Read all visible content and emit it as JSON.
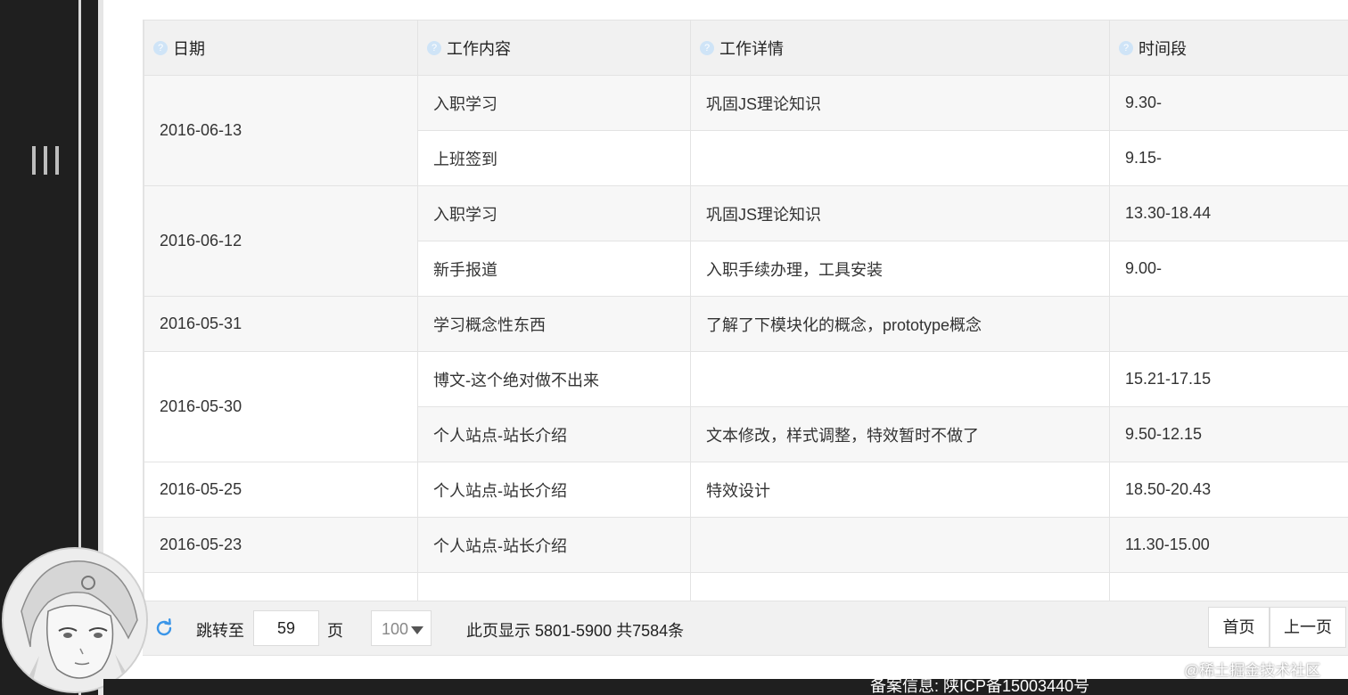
{
  "table": {
    "headers": [
      "日期",
      "工作内容",
      "工作详情",
      "时间段"
    ],
    "rows": [
      {
        "date": "2016-06-13",
        "content": "入职学习",
        "detail": "巩固JS理论知识",
        "time": "9.30-"
      },
      {
        "date": "",
        "content": "上班签到",
        "detail": "",
        "time": "9.15-"
      },
      {
        "date": "2016-06-12",
        "content": "入职学习",
        "detail": "巩固JS理论知识",
        "time": "13.30-18.44"
      },
      {
        "date": "",
        "content": "新手报道",
        "detail": "入职手续办理，工具安装",
        "time": "9.00-"
      },
      {
        "date": "2016-05-31",
        "content": "学习概念性东西",
        "detail": "了解了下模块化的概念，prototype概念",
        "time": ""
      },
      {
        "date": "2016-05-30",
        "content": "博文-这个绝对做不出来",
        "detail": "",
        "time": "15.21-17.15"
      },
      {
        "date": "",
        "content": "个人站点-站长介绍",
        "detail": "文本修改，样式调整，特效暂时不做了",
        "time": "9.50-12.15"
      },
      {
        "date": "2016-05-25",
        "content": "个人站点-站长介绍",
        "detail": "特效设计",
        "time": "18.50-20.43"
      },
      {
        "date": "2016-05-23",
        "content": "个人站点-站长介绍",
        "detail": "",
        "time": "11.30-15.00"
      }
    ]
  },
  "pagination": {
    "jump_label": "跳转至",
    "page_value": "59",
    "page_unit": "页",
    "page_size": "100",
    "info": "此页显示 5801-5900 共7584条",
    "first_label": "首页",
    "prev_label": "上一页"
  },
  "footer": {
    "record": "备案信息: 陕ICP备15003440号",
    "watermark": "@稀土掘金技术社区"
  },
  "icons": {
    "menu": "menu-icon",
    "help": "help-icon",
    "refresh": "refresh-icon",
    "dropdown": "chevron-down-icon"
  },
  "colors": {
    "sidebar": "#1f1f1f",
    "header_bg": "#f1f1f1",
    "refresh": "#3a95e8"
  }
}
